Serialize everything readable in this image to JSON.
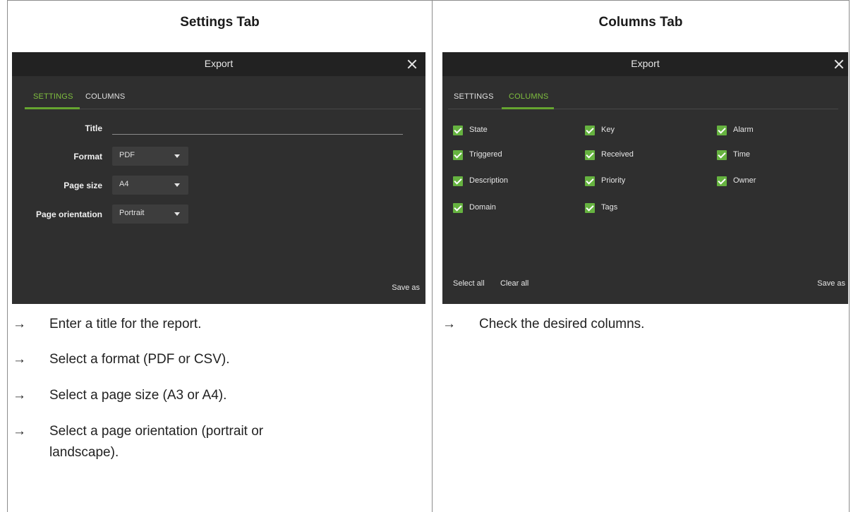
{
  "settings_column": {
    "heading": "Settings Tab",
    "dialog": {
      "title": "Export",
      "tabs": [
        "SETTINGS",
        "COLUMNS"
      ],
      "active_tab": "SETTINGS",
      "fields": {
        "title_label": "Title",
        "title_value": "",
        "format_label": "Format",
        "format_value": "PDF",
        "page_size_label": "Page size",
        "page_size_value": "A4",
        "orientation_label": "Page orientation",
        "orientation_value": "Portrait"
      },
      "save_label": "Save as"
    },
    "bullets": [
      "Enter a title for the report.",
      "Select a format (PDF or CSV).",
      "Select a page size (A3 or A4).",
      "Select a page orientation (portrait or landscape)."
    ]
  },
  "columns_column": {
    "heading": "Columns Tab",
    "dialog": {
      "title": "Export",
      "tabs": [
        "SETTINGS",
        "COLUMNS"
      ],
      "active_tab": "COLUMNS",
      "checkboxes": [
        {
          "label": "State",
          "checked": true
        },
        {
          "label": "Key",
          "checked": true
        },
        {
          "label": "Alarm",
          "checked": true
        },
        {
          "label": "Triggered",
          "checked": true
        },
        {
          "label": "Received",
          "checked": true
        },
        {
          "label": "Time",
          "checked": true
        },
        {
          "label": "Description",
          "checked": true
        },
        {
          "label": "Priority",
          "checked": true
        },
        {
          "label": "Owner",
          "checked": true
        },
        {
          "label": "Domain",
          "checked": true
        },
        {
          "label": "Tags",
          "checked": true
        }
      ],
      "select_all_label": "Select all",
      "clear_all_label": "Clear all",
      "save_label": "Save as"
    },
    "bullets": [
      "Check the desired columns."
    ]
  },
  "arrow_glyph": "→",
  "colors": {
    "dialog_bg": "#2f2f2f",
    "titlebar_bg": "#222222",
    "accent_green": "#66a530",
    "checkbox_green": "#66b340"
  }
}
